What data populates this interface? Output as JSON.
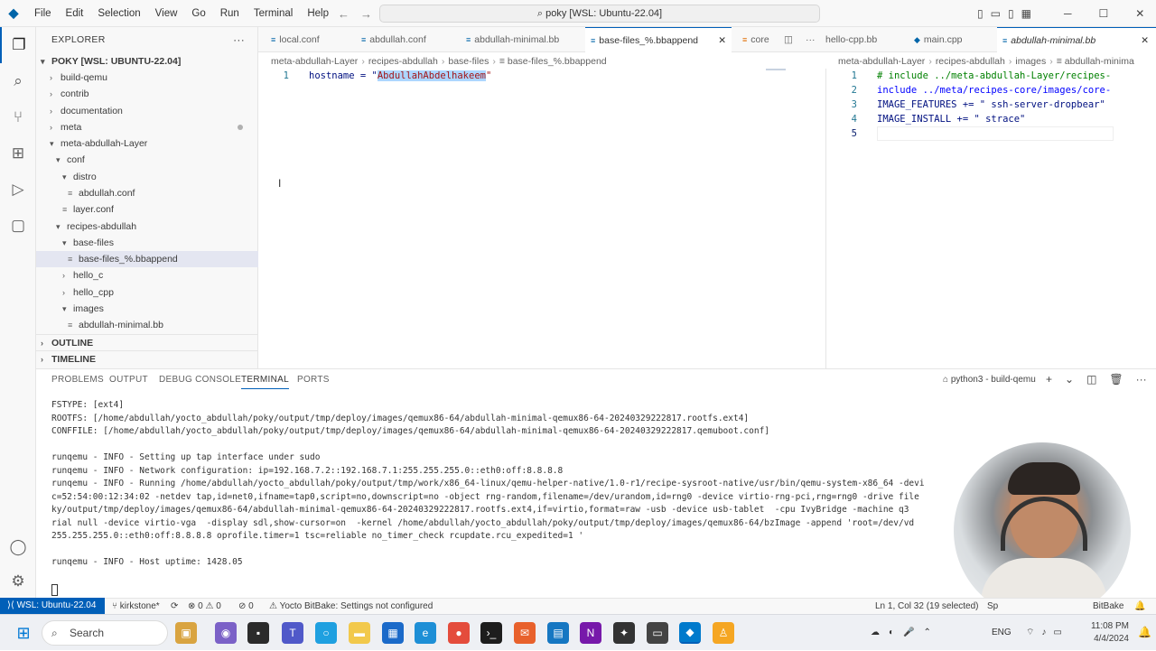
{
  "titlebar": {
    "menu": [
      "File",
      "Edit",
      "Selection",
      "View",
      "Go",
      "Run",
      "Terminal",
      "Help"
    ],
    "command_center": "poky [WSL: Ubuntu-22.04]"
  },
  "sidebar": {
    "explorer_title": "EXPLORER",
    "root": "POKY [WSL: UBUNTU-22.04]",
    "items": [
      {
        "label": "build-qemu"
      },
      {
        "label": "contrib"
      },
      {
        "label": "documentation"
      },
      {
        "label": "meta"
      },
      {
        "label": "meta-abdullah-Layer"
      },
      {
        "label": "conf"
      },
      {
        "label": "distro"
      },
      {
        "label": "abdullah.conf"
      },
      {
        "label": "layer.conf"
      },
      {
        "label": "recipes-abdullah"
      },
      {
        "label": "base-files"
      },
      {
        "label": "base-files_%.bbappend"
      },
      {
        "label": "hello_c"
      },
      {
        "label": "hello_cpp"
      },
      {
        "label": "images"
      },
      {
        "label": "abdullah-minimal.bb"
      }
    ],
    "outline": "OUTLINE",
    "timeline": "TIMELINE"
  },
  "tabs": [
    {
      "label": "local.conf"
    },
    {
      "label": "abdullah.conf"
    },
    {
      "label": "abdullah-minimal.bb"
    },
    {
      "label": "base-files_%.bbappend"
    },
    {
      "label": "core"
    },
    {
      "label": "hello-cpp.bb"
    },
    {
      "label": "main.cpp"
    },
    {
      "label": "abdullah-minimal.bb"
    }
  ],
  "breadcrumbs_left": [
    "meta-abdullah-Layer",
    "recipes-abdullah",
    "base-files",
    "base-files_%.bbappend"
  ],
  "breadcrumbs_right": [
    "meta-abdullah-Layer",
    "recipes-abdullah",
    "images",
    "abdullah-minima"
  ],
  "editor_left": {
    "line1_num": "1",
    "line1_key": "hostname = \"",
    "line1_value": "AbdullahAbdelhakeem",
    "line1_end": "\""
  },
  "editor_right": {
    "lines": [
      {
        "n": "1",
        "text": "# include ../meta-abdullah-Layer/recipes-"
      },
      {
        "n": "2",
        "text": "include ../meta/recipes-core/images/core-"
      },
      {
        "n": "3",
        "text": "IMAGE_FEATURES += \" ssh-server-dropbear\""
      },
      {
        "n": "4",
        "text": "IMAGE_INSTALL += \" strace\""
      },
      {
        "n": "5",
        "text": ""
      }
    ]
  },
  "panel": {
    "tabs": [
      "PROBLEMS",
      "OUTPUT",
      "DEBUG CONSOLE",
      "TERMINAL",
      "PORTS"
    ],
    "terminal_name": "python3 - build-qemu",
    "lines": [
      "FSTYPE: [ext4]",
      "ROOTFS: [/home/abdullah/yocto_abdullah/poky/output/tmp/deploy/images/qemux86-64/abdullah-minimal-qemux86-64-20240329222817.rootfs.ext4]",
      "CONFFILE: [/home/abdullah/yocto_abdullah/poky/output/tmp/deploy/images/qemux86-64/abdullah-minimal-qemux86-64-20240329222817.qemuboot.conf]",
      "",
      "runqemu - INFO - Setting up tap interface under sudo",
      "runqemu - INFO - Network configuration: ip=192.168.7.2::192.168.7.1:255.255.255.0::eth0:off:8.8.8.8",
      "runqemu - INFO - Running /home/abdullah/yocto_abdullah/poky/output/tmp/work/x86_64-linux/qemu-helper-native/1.0-r1/recipe-sysroot-native/usr/bin/qemu-system-x86_64 -devi",
      "c=52:54:00:12:34:02 -netdev tap,id=net0,ifname=tap0,script=no,downscript=no -object rng-random,filename=/dev/urandom,id=rng0 -device virtio-rng-pci,rng=rng0 -drive file",
      "ky/output/tmp/deploy/images/qemux86-64/abdullah-minimal-qemux86-64-20240329222817.rootfs.ext4,if=virtio,format=raw -usb -device usb-tablet  -cpu IvyBridge -machine q3",
      "rial null -device virtio-vga  -display sdl,show-cursor=on  -kernel /home/abdullah/yocto_abdullah/poky/output/tmp/deploy/images/qemux86-64/bzImage -append 'root=/dev/vd",
      "255.255.255.0::eth0:off:8.8.8.8 oprofile.timer=1 tsc=reliable no_timer_check rcupdate.rcu_expedited=1 '",
      "",
      "runqemu - INFO - Host uptime: 1428.05"
    ]
  },
  "statusbar": {
    "remote": "WSL: Ubuntu-22.04",
    "branch": "kirkstone*",
    "errors": "0",
    "warnings": "0",
    "ports": "0",
    "bitbake": "Yocto BitBake: Settings not configured",
    "position": "Ln 1, Col 32 (19 selected)",
    "sp": "Sp",
    "bitbake_lang": "BitBake"
  },
  "taskbar": {
    "search": "Search",
    "lang": "ENG",
    "time": "11:08 PM",
    "date": "4/4/2024"
  }
}
